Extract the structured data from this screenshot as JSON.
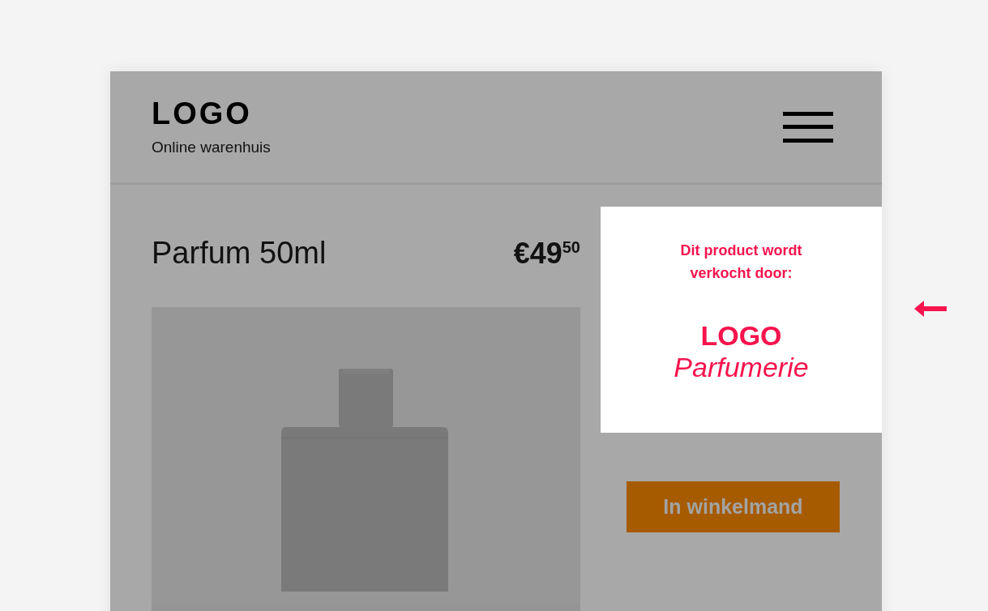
{
  "header": {
    "logo": "LOGO",
    "tagline": "Online warenhuis"
  },
  "product": {
    "title": "Parfum 50ml",
    "price": "€49$^{50}$"
  },
  "seller": {
    "intro": "Dit product wordt verkocht door:",
    "logo": "LOGO",
    "name": "Parfumerie"
  },
  "buttons": [
    {
      "label": "In winkelmand"
    }
  ]
}
